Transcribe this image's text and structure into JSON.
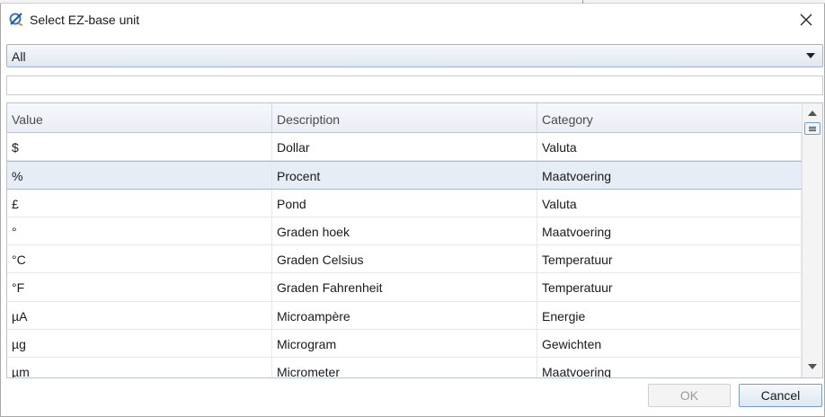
{
  "window": {
    "title": "Select EZ-base unit"
  },
  "category_filter": {
    "selected": "All"
  },
  "search": {
    "value": "",
    "placeholder": ""
  },
  "grid": {
    "columns": [
      "Value",
      "Description",
      "Category"
    ],
    "selected_index": 1,
    "rows": [
      {
        "value": "$",
        "description": "Dollar",
        "category": "Valuta"
      },
      {
        "value": "%",
        "description": "Procent",
        "category": "Maatvoering"
      },
      {
        "value": "£",
        "description": "Pond",
        "category": "Valuta"
      },
      {
        "value": "°",
        "description": "Graden hoek",
        "category": "Maatvoering"
      },
      {
        "value": "°C",
        "description": "Graden Celsius",
        "category": "Temperatuur"
      },
      {
        "value": "°F",
        "description": "Graden Fahrenheit",
        "category": "Temperatuur"
      },
      {
        "value": "µA",
        "description": "Microampère",
        "category": "Energie"
      },
      {
        "value": "µg",
        "description": "Microgram",
        "category": "Gewichten"
      },
      {
        "value": "µm",
        "description": "Micrometer",
        "category": "Maatvoering"
      }
    ]
  },
  "buttons": {
    "ok_label": "OK",
    "ok_enabled": false,
    "cancel_label": "Cancel"
  },
  "colors": {
    "accent": "#7a9cc4",
    "selection": "#e6edf6",
    "header": "#e9eef5"
  },
  "icons": {
    "app": "ez-logo-icon",
    "close": "close-icon",
    "dropdown": "chevron-down-icon"
  }
}
